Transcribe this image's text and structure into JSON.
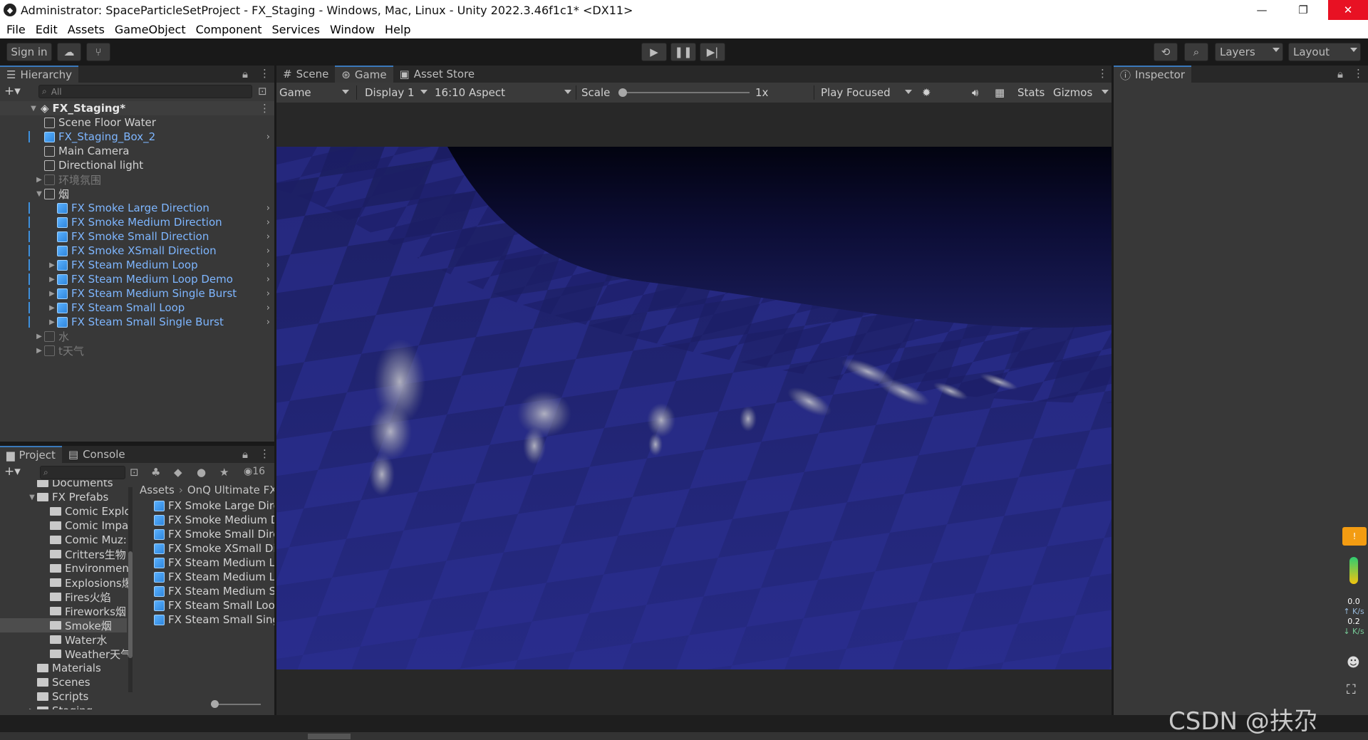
{
  "window": {
    "title": "Administrator: SpaceParticleSetProject - FX_Staging - Windows, Mac, Linux - Unity 2022.3.46f1c1* <DX11>",
    "app_icon": "unity-logo-icon"
  },
  "menu": [
    "File",
    "Edit",
    "Assets",
    "GameObject",
    "Component",
    "Services",
    "Window",
    "Help"
  ],
  "toolbar": {
    "sign_in": "Sign in",
    "layers": "Layers",
    "layout": "Layout"
  },
  "hierarchy": {
    "tab": "Hierarchy",
    "search_placeholder": "All",
    "scene": "FX_Staging*",
    "items": [
      {
        "label": "Scene Floor Water",
        "style": "normal"
      },
      {
        "label": "FX_Staging_Box_2",
        "style": "blue"
      },
      {
        "label": "Main Camera",
        "style": "normal"
      },
      {
        "label": "Directional light",
        "style": "normal"
      },
      {
        "label": "环境氛围",
        "style": "dim"
      },
      {
        "label": "烟",
        "style": "normal"
      },
      {
        "label": "FX Smoke Large Direction",
        "style": "blue"
      },
      {
        "label": "FX Smoke Medium Direction",
        "style": "blue"
      },
      {
        "label": "FX Smoke Small Direction",
        "style": "blue"
      },
      {
        "label": "FX Smoke XSmall Direction",
        "style": "blue"
      },
      {
        "label": "FX Steam Medium Loop",
        "style": "blue"
      },
      {
        "label": "FX Steam Medium Loop Demo",
        "style": "blue"
      },
      {
        "label": "FX Steam Medium Single Burst",
        "style": "blue"
      },
      {
        "label": "FX Steam Small Loop",
        "style": "blue"
      },
      {
        "label": "FX Steam Small Single Burst",
        "style": "blue"
      },
      {
        "label": "水",
        "style": "dim"
      },
      {
        "label": "t天气",
        "style": "dim"
      }
    ]
  },
  "project": {
    "tabs": [
      "Project",
      "Console"
    ],
    "hidden_count": "16",
    "breadcrumb": [
      "Assets",
      "OnQ Ultimate FX"
    ],
    "folders": [
      "Documents",
      "FX Prefabs",
      "Comic Explc",
      "Comic Impa",
      "Comic Muz:",
      "Critters生物",
      "Environmen",
      "Explosions爆",
      "Fires火焰",
      "Fireworks烟",
      "Smoke烟",
      "Water水",
      "Weather天气",
      "Materials",
      "Scenes",
      "Scripts",
      "Staging"
    ],
    "assets": [
      "FX Smoke Large Dire",
      "FX Smoke Medium D",
      "FX Smoke Small Dire",
      "FX Smoke XSmall Di",
      "FX Steam Medium Lc",
      "FX Steam Medium Lc",
      "FX Steam Medium Si",
      "FX Steam Small Loop",
      "FX Steam Small Sing"
    ]
  },
  "view_tabs": [
    "Scene",
    "Game",
    "Asset Store"
  ],
  "game_bar": {
    "view": "Game",
    "display": "Display 1",
    "aspect": "16:10 Aspect",
    "scale_label": "Scale",
    "scale_value": "1x",
    "play_mode": "Play Focused",
    "stats": "Stats",
    "gizmos": "Gizmos"
  },
  "inspector": {
    "tab": "Inspector"
  },
  "net_monitor": {
    "up_value": "0.0",
    "up_unit": "K/s",
    "down_value": "0.2",
    "down_unit": "K/s"
  },
  "watermark": "CSDN @扶尕"
}
